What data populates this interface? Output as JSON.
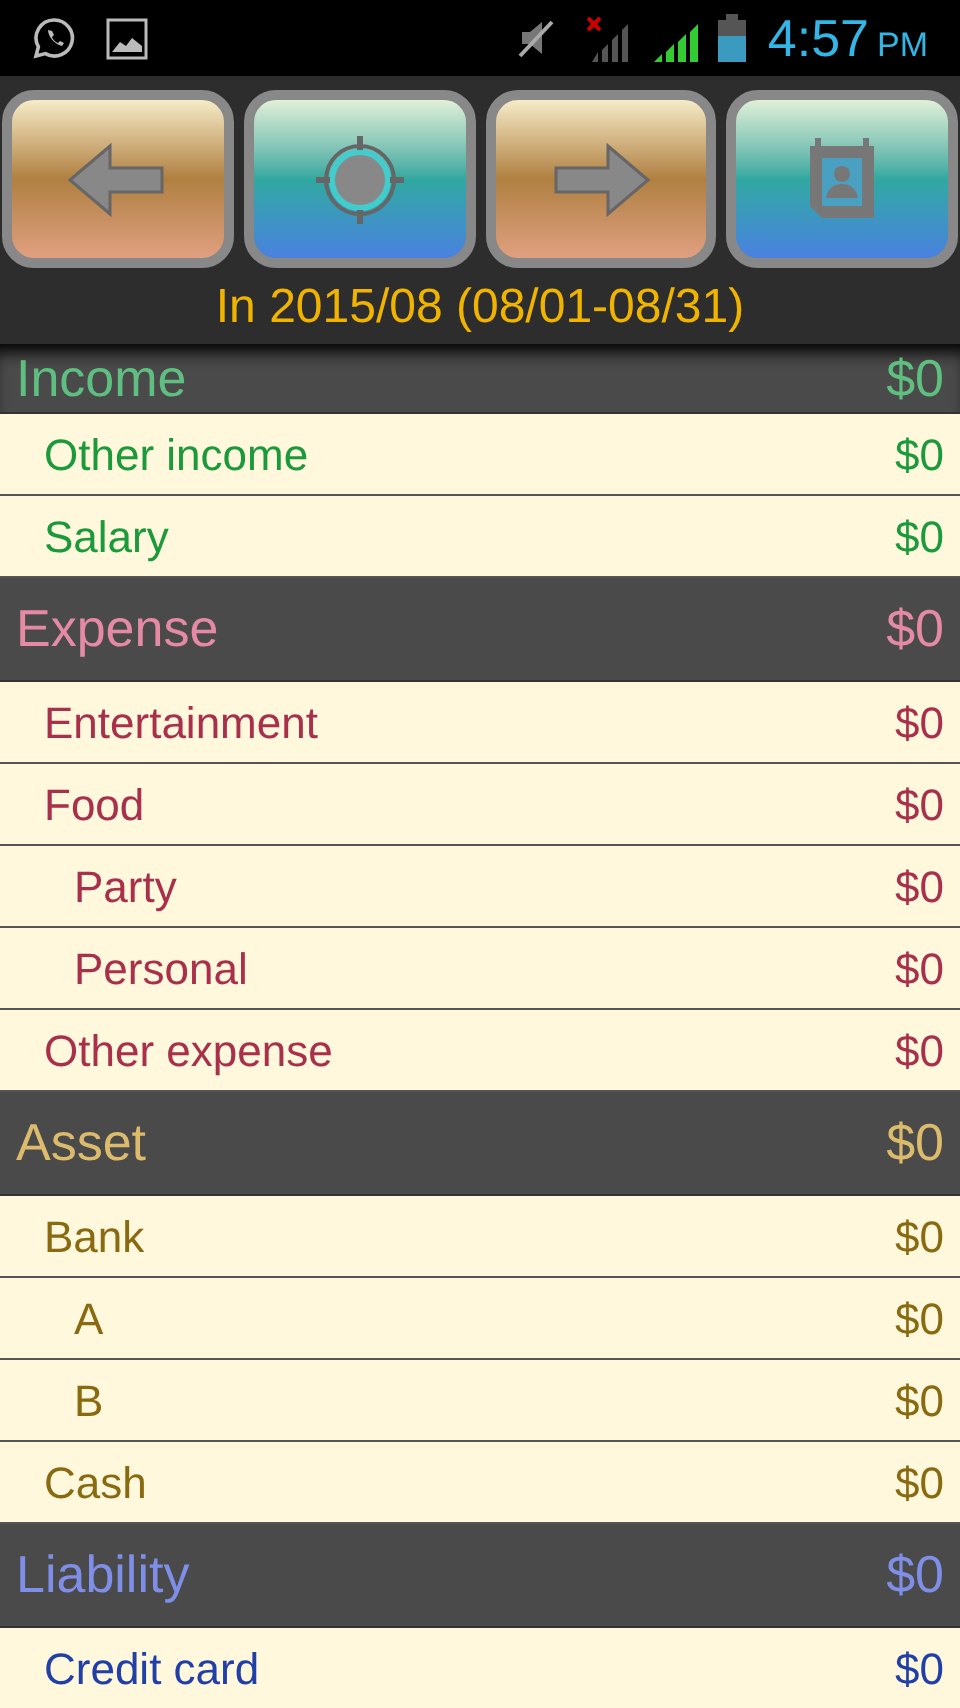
{
  "status_bar": {
    "time": "4:57",
    "ampm": "PM"
  },
  "toolbar": {
    "buttons": [
      {
        "kind": "back"
      },
      {
        "kind": "target"
      },
      {
        "kind": "forward"
      },
      {
        "kind": "calendar"
      }
    ]
  },
  "period": "In 2015/08 (08/01-08/31)",
  "sections": [
    {
      "kind": "income",
      "name": "Income",
      "amount": "$0",
      "items": [
        {
          "name": "Other income",
          "amount": "$0"
        },
        {
          "name": "Salary",
          "amount": "$0"
        }
      ]
    },
    {
      "kind": "expense",
      "name": "Expense",
      "amount": "$0",
      "items": [
        {
          "name": "Entertainment",
          "amount": "$0"
        },
        {
          "name": "Food",
          "amount": "$0",
          "children": [
            {
              "name": "Party",
              "amount": "$0"
            },
            {
              "name": "Personal",
              "amount": "$0"
            }
          ]
        },
        {
          "name": "Other expense",
          "amount": "$0"
        }
      ]
    },
    {
      "kind": "asset",
      "name": "Asset",
      "amount": "$0",
      "items": [
        {
          "name": "Bank",
          "amount": "$0",
          "children": [
            {
              "name": "A",
              "amount": "$0"
            },
            {
              "name": "B",
              "amount": "$0"
            }
          ]
        },
        {
          "name": "Cash",
          "amount": "$0"
        }
      ]
    },
    {
      "kind": "liability",
      "name": "Liability",
      "amount": "$0",
      "items": [
        {
          "name": "Credit card",
          "amount": "$0"
        }
      ]
    }
  ]
}
